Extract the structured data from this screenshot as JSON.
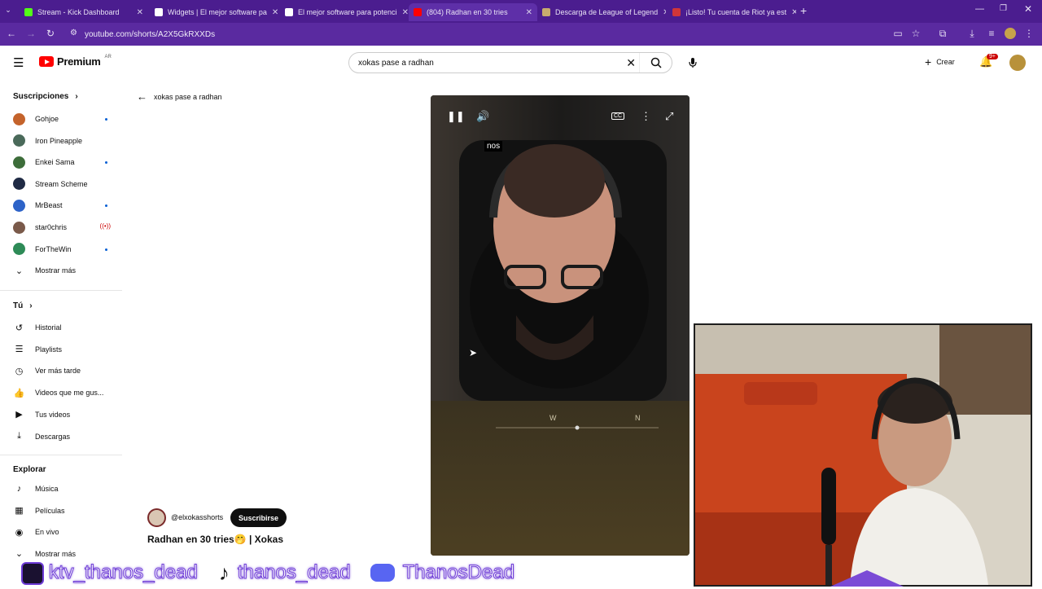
{
  "browser": {
    "tabs": [
      {
        "title": "Stream - Kick Dashboard",
        "color": "#53fc18"
      },
      {
        "title": "Widgets | El mejor software pa",
        "color": "#ffffff"
      },
      {
        "title": "El mejor software para potenci",
        "color": "#ffffff"
      },
      {
        "title": "(804) Radhan en 30 tries",
        "color": "#ff0000"
      },
      {
        "title": "Descarga de League of Legend",
        "color": "#c8aa6e"
      },
      {
        "title": "¡Listo! Tu cuenta de Riot ya est",
        "color": "#d13639"
      }
    ],
    "url": "youtube.com/shorts/A2X5GkRXXDs"
  },
  "youtube": {
    "logo_text": "Premium",
    "logo_region": "AR",
    "search_value": "xokas pase a radhan",
    "create_label": "Crear",
    "notif_count": "9+",
    "back_label": "xokas pase a radhan",
    "subs_header": "Suscripciones",
    "subs": [
      {
        "name": "Gohjoe",
        "color": "#c4632b",
        "badge": "dot"
      },
      {
        "name": "Iron Pineapple",
        "color": "#4a6a5a",
        "badge": ""
      },
      {
        "name": "Enkei Sama",
        "color": "#3d6d3a",
        "badge": "dot"
      },
      {
        "name": "Stream Scheme",
        "color": "#1f2a44",
        "badge": ""
      },
      {
        "name": "MrBeast",
        "color": "#2d63c8",
        "badge": "dot"
      },
      {
        "name": "star0chris",
        "color": "#7a5a4a",
        "badge": "live"
      },
      {
        "name": "ForTheWin",
        "color": "#2e8b57",
        "badge": "dot"
      }
    ],
    "more_label": "Mostrar más",
    "you_header": "Tú",
    "you_items": [
      {
        "label": "Historial",
        "icon": "history-icon",
        "glyph": "↺"
      },
      {
        "label": "Playlists",
        "icon": "playlist-icon",
        "glyph": "☰"
      },
      {
        "label": "Ver más tarde",
        "icon": "clock-icon",
        "glyph": "◷"
      },
      {
        "label": "Videos que me gus...",
        "icon": "thumb-up-icon",
        "glyph": "👍"
      },
      {
        "label": "Tus videos",
        "icon": "video-icon",
        "glyph": "▶"
      },
      {
        "label": "Descargas",
        "icon": "download-icon",
        "glyph": "⤓"
      }
    ],
    "explore_header": "Explorar",
    "explore_items": [
      {
        "label": "Música",
        "icon": "music-icon",
        "glyph": "♪"
      },
      {
        "label": "Películas",
        "icon": "film-icon",
        "glyph": "▦"
      },
      {
        "label": "En vivo",
        "icon": "live-icon",
        "glyph": "◉"
      },
      {
        "label": "Mostrar más",
        "icon": "chevron-down-icon",
        "glyph": "⌄"
      }
    ],
    "short": {
      "channel": "@elxokasshorts",
      "subscribe_label": "Suscribirse",
      "title": "Radhan en 30 tries🤭 | Xokas",
      "caption": "nos",
      "compass_w": "W",
      "compass_n": "N"
    }
  },
  "overlay": {
    "kick_name": "ktv_thanos_dead",
    "tiktok_name": "thanos_dead",
    "discord_name": "ThanosDead",
    "kick_color": "#6d3bd6"
  }
}
